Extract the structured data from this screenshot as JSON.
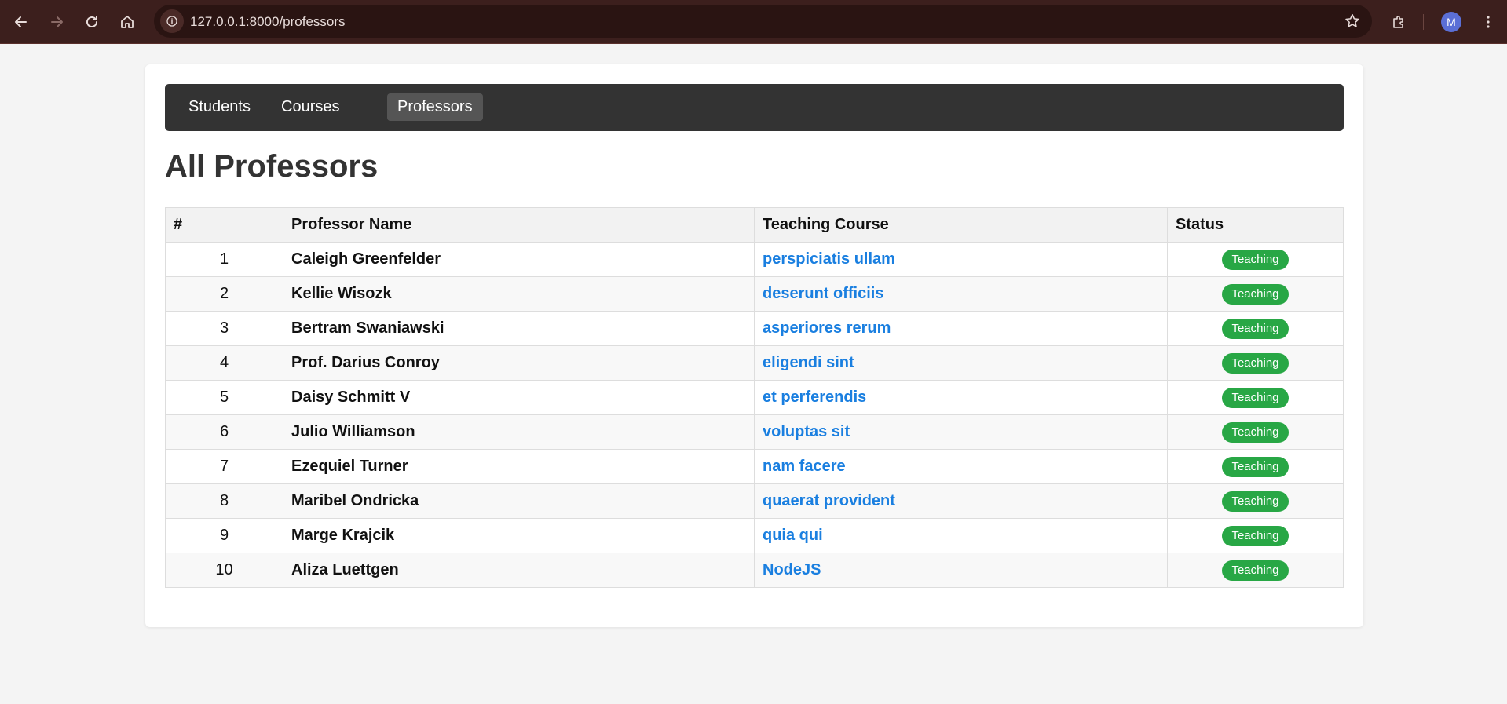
{
  "browser": {
    "url": "127.0.0.1:8000/professors",
    "profile_initial": "M"
  },
  "nav": {
    "items": [
      {
        "label": "Students",
        "active": false
      },
      {
        "label": "Courses",
        "active": false
      },
      {
        "label": "Professors",
        "active": true
      }
    ]
  },
  "page": {
    "title": "All Professors"
  },
  "table": {
    "headers": [
      "#",
      "Professor Name",
      "Teaching Course",
      "Status"
    ],
    "rows": [
      {
        "num": "1",
        "name": "Caleigh Greenfelder",
        "course": "perspiciatis ullam",
        "status": "Teaching"
      },
      {
        "num": "2",
        "name": "Kellie Wisozk",
        "course": "deserunt officiis",
        "status": "Teaching"
      },
      {
        "num": "3",
        "name": "Bertram Swaniawski",
        "course": "asperiores rerum",
        "status": "Teaching"
      },
      {
        "num": "4",
        "name": "Prof. Darius Conroy",
        "course": "eligendi sint",
        "status": "Teaching"
      },
      {
        "num": "5",
        "name": "Daisy Schmitt V",
        "course": "et perferendis",
        "status": "Teaching"
      },
      {
        "num": "6",
        "name": "Julio Williamson",
        "course": "voluptas sit",
        "status": "Teaching"
      },
      {
        "num": "7",
        "name": "Ezequiel Turner",
        "course": "nam facere",
        "status": "Teaching"
      },
      {
        "num": "8",
        "name": "Maribel Ondricka",
        "course": "quaerat provident",
        "status": "Teaching"
      },
      {
        "num": "9",
        "name": "Marge Krajcik",
        "course": "quia qui",
        "status": "Teaching"
      },
      {
        "num": "10",
        "name": "Aliza Luettgen",
        "course": "NodeJS",
        "status": "Teaching"
      }
    ]
  },
  "colors": {
    "nav_bg": "#333333",
    "link": "#1a7fe0",
    "badge": "#28a745",
    "chrome": "#3c1f1d"
  }
}
